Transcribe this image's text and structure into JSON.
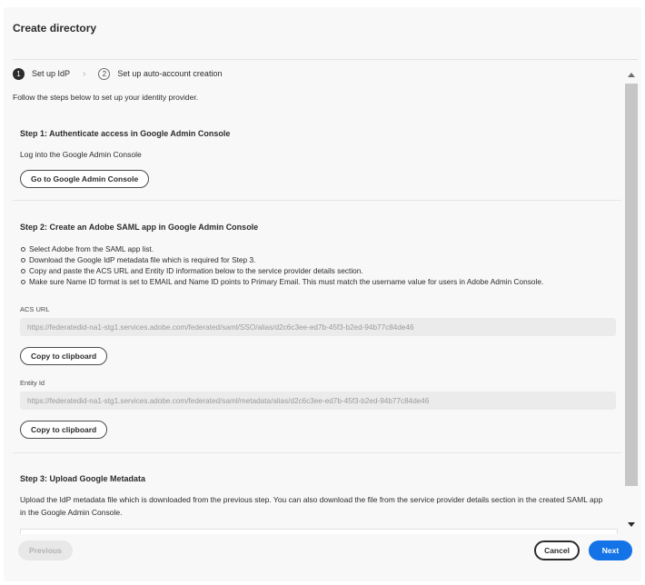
{
  "dialog": {
    "title": "Create directory"
  },
  "steps": [
    {
      "number": "1",
      "label": "Set up IdP"
    },
    {
      "number": "2",
      "label": "Set up auto-account creation"
    }
  ],
  "intro": "Follow the steps below to set up your identity provider.",
  "step1": {
    "heading": "Step 1: Authenticate access in Google Admin Console",
    "text": "Log into the Google Admin Console",
    "button": "Go to Google Admin Console"
  },
  "step2": {
    "heading": "Step 2: Create an Adobe SAML app in Google Admin Console",
    "bullets": [
      "Select Adobe from the SAML app list.",
      "Download the Google IdP metadata file which is required for Step 3.",
      "Copy and paste the ACS URL and Entity ID information below to the service provider details section.",
      "Make sure Name ID format is set to EMAIL and Name ID points to Primary Email. This must match the username value for users in Adobe Admin Console."
    ],
    "acs_label": "ACS URL",
    "acs_value": "https://federatedid-na1-stg1.services.adobe.com/federated/saml/SSO/alias/d2c6c3ee-ed7b-45f3-b2ed-94b77c84de46",
    "copy_button": "Copy to clipboard",
    "entity_label": "Entity Id",
    "entity_value": "https://federatedid-na1-stg1.services.adobe.com/federated/saml/metadata/alias/d2c6c3ee-ed7b-45f3-b2ed-94b77c84de46",
    "copy_button_2": "Copy to clipboard"
  },
  "step3": {
    "heading": "Step 3: Upload Google Metadata",
    "text_line1": "Upload the IdP metadata file which is downloaded from the previous step. You can also download the file from the service provider details section in the created SAML app",
    "text_line2": "in the Google Admin Console."
  },
  "footer": {
    "previous": "Previous",
    "cancel": "Cancel",
    "next": "Next"
  },
  "colors": {
    "accent": "#1473e6",
    "active_step": "#2c2c2c"
  }
}
